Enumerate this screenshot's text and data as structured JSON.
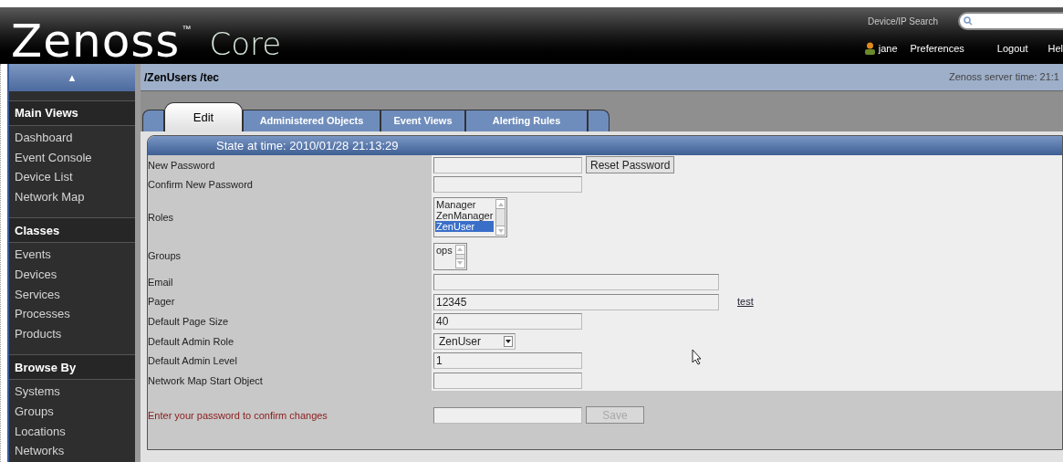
{
  "header": {
    "logo": "Zenoss",
    "trademark": "™",
    "product": "Core",
    "search_label": "Device/IP Search",
    "user": "jane",
    "links": [
      "Preferences",
      "Logout",
      "Hel"
    ]
  },
  "breadcrumb": {
    "path": "/ZenUsers /tec",
    "server_time": "Zenoss server time: 21:1"
  },
  "sidebar": {
    "collapse": "▲",
    "sections": [
      {
        "title": "Main Views",
        "items": [
          "Dashboard",
          "Event Console",
          "Device List",
          "Network Map"
        ]
      },
      {
        "title": "Classes",
        "items": [
          "Events",
          "Devices",
          "Services",
          "Processes",
          "Products"
        ]
      },
      {
        "title": "Browse By",
        "items": [
          "Systems",
          "Groups",
          "Locations",
          "Networks"
        ]
      }
    ]
  },
  "tabs": [
    {
      "label": "Edit",
      "selected": true
    },
    {
      "label": "Administered Objects",
      "selected": false
    },
    {
      "label": "Event Views",
      "selected": false
    },
    {
      "label": "Alerting Rules",
      "selected": false
    }
  ],
  "panel": {
    "title": "State at time: 2010/01/28 21:13:29",
    "rows": [
      {
        "kind": "password",
        "label": "New Password",
        "button": "Reset Password"
      },
      {
        "kind": "password",
        "label": "Confirm New Password"
      },
      {
        "kind": "listbox",
        "label": "Roles",
        "options": [
          {
            "label": "Manager",
            "selected": false
          },
          {
            "label": "ZenManager",
            "selected": false
          },
          {
            "label": "ZenUser",
            "selected": true
          }
        ]
      },
      {
        "kind": "listbox",
        "label": "Groups",
        "options": [
          {
            "label": "ops",
            "selected": false
          }
        ]
      },
      {
        "kind": "wide",
        "label": "Email"
      },
      {
        "kind": "wide",
        "label": "Pager",
        "value": "12345",
        "link": "test"
      },
      {
        "kind": "text",
        "label": "Default Page Size",
        "value": "40"
      },
      {
        "kind": "select",
        "label": "Default Admin Role",
        "value": "ZenUser"
      },
      {
        "kind": "text",
        "label": "Default Admin Level",
        "value": "1"
      },
      {
        "kind": "text",
        "label": "Network Map Start Object"
      }
    ],
    "confirm": {
      "label": "Enter your password to confirm changes",
      "button": "Save",
      "disabled": true
    }
  }
}
